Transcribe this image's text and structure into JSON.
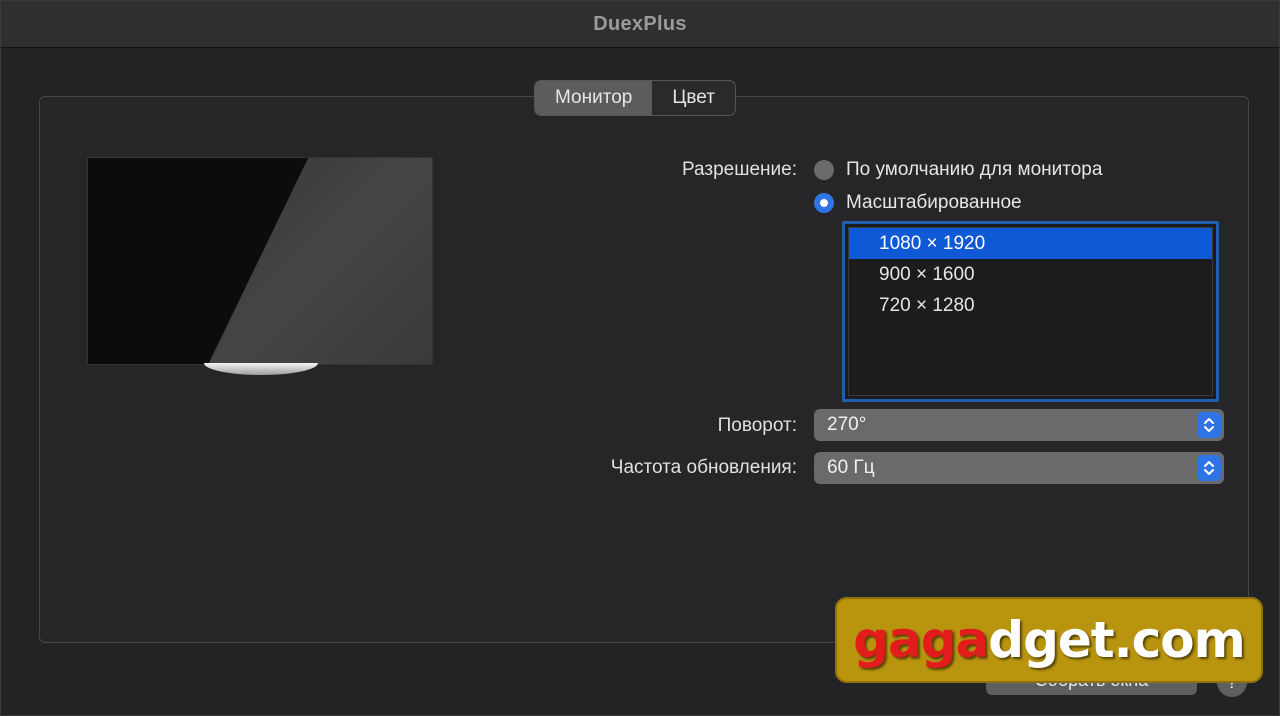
{
  "window": {
    "title": "DuexPlus"
  },
  "tabs": [
    {
      "label": "Монитор",
      "active": true
    },
    {
      "label": "Цвет",
      "active": false
    }
  ],
  "resolution": {
    "label": "Разрешение:",
    "options": [
      {
        "label": "По умолчанию для монитора",
        "selected": false
      },
      {
        "label": "Масштабированное",
        "selected": true
      }
    ],
    "list": [
      {
        "label": "1080 × 1920",
        "selected": true
      },
      {
        "label": "900 × 1600",
        "selected": false
      },
      {
        "label": "720 × 1280",
        "selected": false
      }
    ]
  },
  "rotation": {
    "label": "Поворот:",
    "value": "270°"
  },
  "refresh": {
    "label": "Частота обновления:",
    "value": "60 Гц"
  },
  "footer": {
    "gather_button": "Собрать окна",
    "help_button": "?"
  },
  "watermark": {
    "part1": "ga",
    "part2": "ga",
    "part3": "dget.com"
  },
  "colors": {
    "accent": "#2f74e5",
    "selection": "#0f58d6",
    "watermark_bg": "#b8940f"
  }
}
